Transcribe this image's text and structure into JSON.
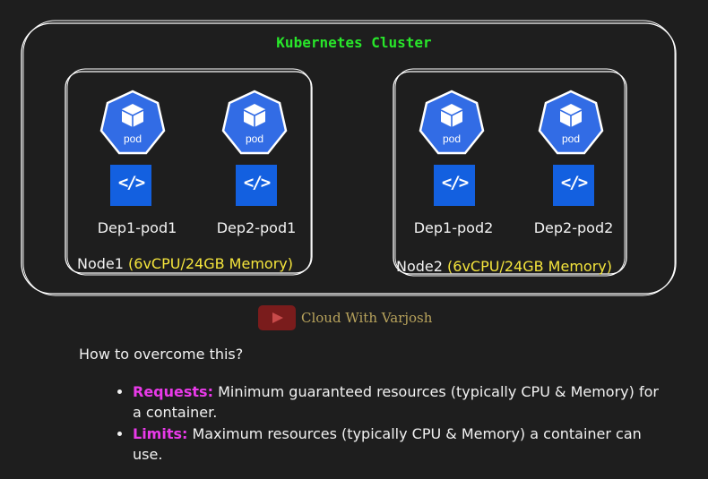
{
  "cluster": {
    "title": "Kubernetes Cluster"
  },
  "nodes": [
    {
      "name": "Node1",
      "spec": "(6vCPU/24GB Memory)",
      "pods": [
        {
          "icon_label": "pod",
          "name": "Dep1-pod1"
        },
        {
          "icon_label": "pod",
          "name": "Dep2-pod1"
        }
      ]
    },
    {
      "name": "Node2",
      "spec": "(6vCPU/24GB Memory)",
      "pods": [
        {
          "icon_label": "pod",
          "name": "Dep1-pod2"
        },
        {
          "icon_label": "pod",
          "name": "Dep2-pod2"
        }
      ]
    }
  ],
  "code_icon_glyph": "</>",
  "brand": {
    "text": "Cloud With Varjosh",
    "icon": "youtube-icon"
  },
  "question": "How to overcome this?",
  "bullets": [
    {
      "term": "Requests:",
      "text": "Minimum guaranteed resources (typically CPU & Memory) for a container."
    },
    {
      "term": "Limits:",
      "text": "Maximum resources (typically CPU & Memory) a container can use."
    }
  ],
  "colors": {
    "title": "#28e62a",
    "spec": "#f5e53c",
    "term": "#e93ae9",
    "icon_blue": "#326ce5"
  }
}
